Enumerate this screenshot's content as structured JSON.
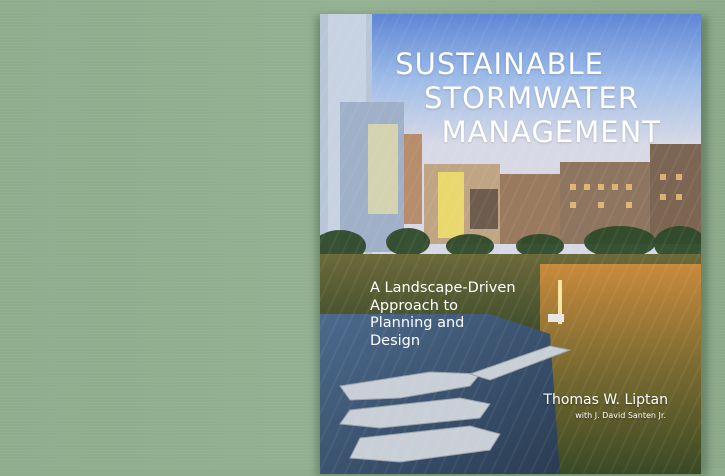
{
  "cover": {
    "title_line1": "SUSTAINABLE",
    "title_line2": "STORMWATER",
    "title_line3": "MANAGEMENT",
    "subtitle_line1": "A Landscape-Driven",
    "subtitle_line2": "Approach to",
    "subtitle_line3": "Planning and",
    "subtitle_line4": "Design",
    "author": "Thomas W. Liptan",
    "coauthor": "with J. David Santen Jr."
  },
  "colors": {
    "background": "#8fae8e",
    "title_text": "#ffffff",
    "sky": "#8fb0e8",
    "water": "#6a88a8",
    "vegetation": "#3f5a2c"
  }
}
